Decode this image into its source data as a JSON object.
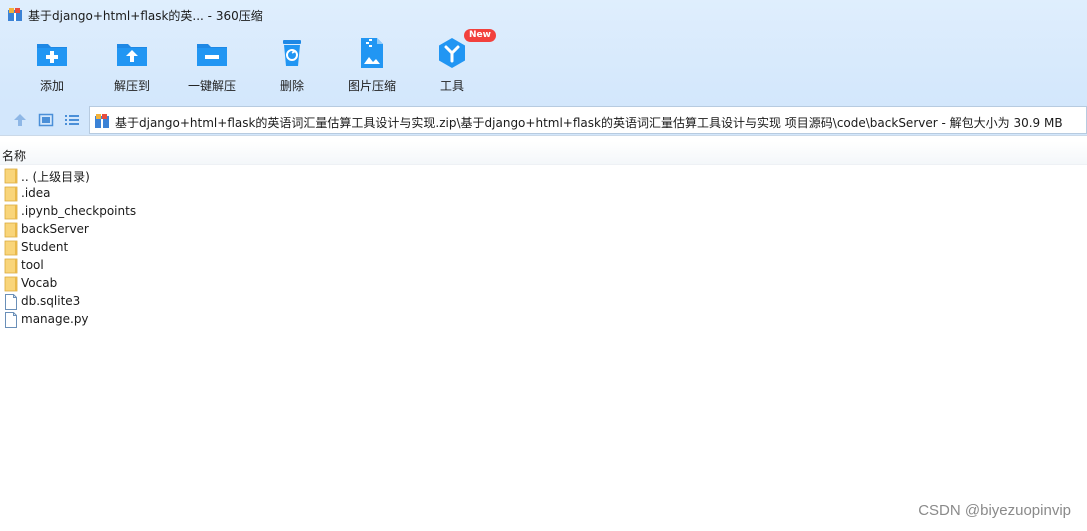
{
  "window": {
    "title": "基于django+html+flask的英... - 360压缩"
  },
  "toolbar": {
    "items": [
      {
        "label": "添加",
        "icon": "add-icon"
      },
      {
        "label": "解压到",
        "icon": "extract-to-icon"
      },
      {
        "label": "一键解压",
        "icon": "one-click-extract-icon"
      },
      {
        "label": "删除",
        "icon": "delete-icon"
      },
      {
        "label": "图片压缩",
        "icon": "image-compress-icon"
      },
      {
        "label": "工具",
        "icon": "tools-icon",
        "badge": "New"
      }
    ]
  },
  "address": {
    "path": "基于django+html+flask的英语词汇量估算工具设计与实现.zip\\基于django+html+flask的英语词汇量估算工具设计与实现 项目源码\\code\\backServer - 解包大小为 30.9 MB"
  },
  "columns": {
    "name": "名称"
  },
  "files": [
    {
      "name": ".. (上级目录)",
      "type": "folder"
    },
    {
      "name": ".idea",
      "type": "folder"
    },
    {
      "name": ".ipynb_checkpoints",
      "type": "folder"
    },
    {
      "name": "backServer",
      "type": "folder"
    },
    {
      "name": "Student",
      "type": "folder"
    },
    {
      "name": "tool",
      "type": "folder"
    },
    {
      "name": "Vocab",
      "type": "folder"
    },
    {
      "name": "db.sqlite3",
      "type": "file"
    },
    {
      "name": "manage.py",
      "type": "file"
    }
  ],
  "watermark": "CSDN @biyezuopinvip",
  "colors": {
    "chrome_bg": "#d3e7fc",
    "icon_blue": "#1e88e5",
    "badge_red": "#f2413d",
    "folder_yellow": "#f9d57a"
  }
}
